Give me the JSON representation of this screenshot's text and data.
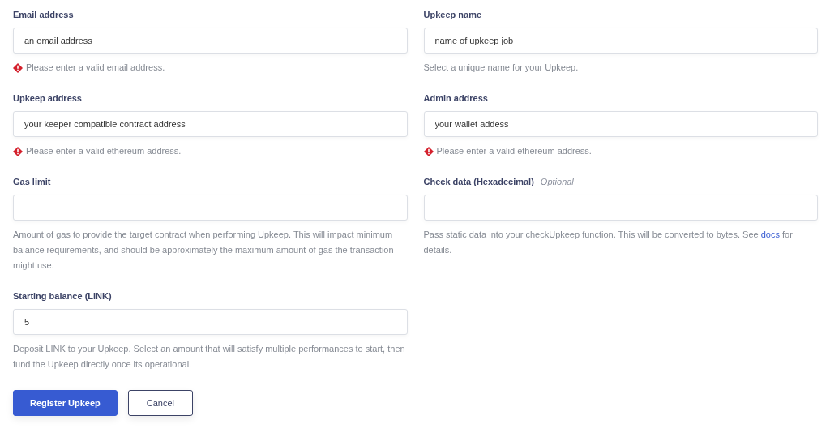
{
  "fields": [
    {
      "label": "Email address",
      "value": "an email address",
      "message": {
        "kind": "error",
        "text": "Please enter a valid email address."
      }
    },
    {
      "label": "Upkeep name",
      "value": "name of upkeep job",
      "message": {
        "kind": "help",
        "text": "Select a unique name for your Upkeep."
      }
    },
    {
      "label": "Upkeep address",
      "value": "your keeper compatible contract address",
      "message": {
        "kind": "error",
        "text": "Please enter a valid ethereum address."
      }
    },
    {
      "label": "Admin address",
      "value": "your wallet addess",
      "message": {
        "kind": "error",
        "text": "Please enter a valid ethereum address."
      }
    },
    {
      "label": "Gas limit",
      "message": {
        "kind": "help",
        "text": "Amount of gas to provide the target contract when performing Upkeep. This will impact minimum balance requirements, and should be approximately the maximum amount of gas the transaction might use."
      }
    },
    {
      "label": "Check data (Hexadecimal)",
      "optional": "Optional",
      "message": {
        "kind": "help",
        "text": "Pass static data into your checkUpkeep function. This will be converted to bytes. See",
        "link": "docs",
        "after": "for details."
      }
    },
    {
      "label": "Starting balance (LINK)",
      "value": "5",
      "message": {
        "kind": "help",
        "text": "Deposit LINK to your Upkeep. Select an amount that will satisfy multiple performances to start, then fund the Upkeep directly once its operational."
      }
    }
  ],
  "buttons": [
    {
      "label": "Register Upkeep",
      "kind": "primary"
    },
    {
      "label": "Cancel",
      "kind": "secondary"
    }
  ]
}
